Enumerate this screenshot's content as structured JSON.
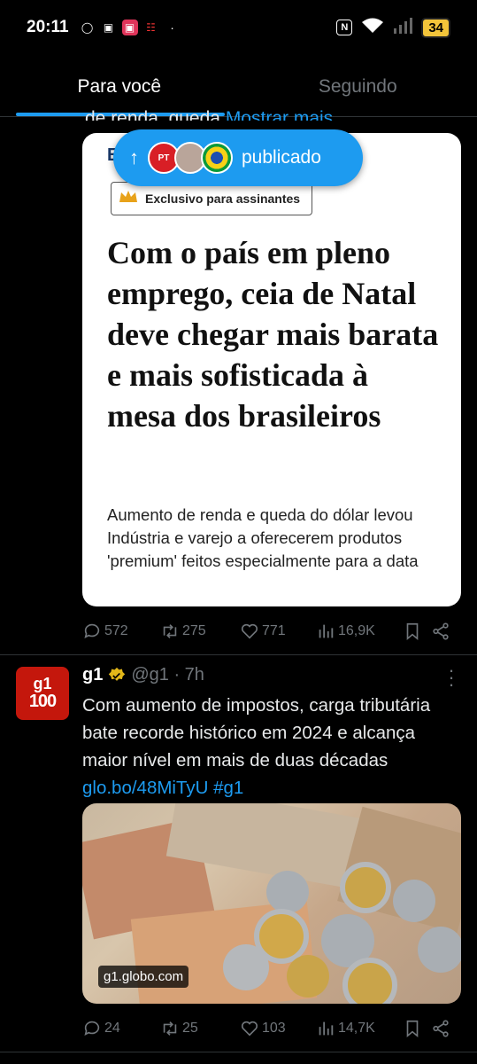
{
  "status_bar": {
    "time": "20:11",
    "battery": "34"
  },
  "tabs": [
    {
      "label": "Para você",
      "active": true
    },
    {
      "label": "Seguindo",
      "active": false
    }
  ],
  "tweet1": {
    "truncated_text": "de renda, queda",
    "show_more": "Mostrar mais",
    "card": {
      "exclusive": "Exclusivo para assinantes",
      "headline": "Com o país em pleno emprego, ceia de Natal deve chegar mais barata e mais sofisticada à mesa dos brasileiros",
      "subhead": "Aumento de renda e queda do dólar levou Indústria e varejo a oferecerem produtos 'premium' feitos especialmente para a data"
    },
    "actions": {
      "replies": "572",
      "retweets": "275",
      "likes": "771",
      "views": "16,9K"
    }
  },
  "published_pill": {
    "label": "publicado",
    "avatar_pt_text": "PT"
  },
  "tweet2": {
    "avatar_top": "g1",
    "avatar_bottom": "100",
    "name": "g1",
    "handle_time": "@g1 · 7h",
    "text": "Com aumento de impostos, carga tributária bate recorde histórico em 2024 e alcança maior nível em mais de duas décadas ",
    "link": "glo.bo/48MiTyU #g1",
    "media_domain": "g1.globo.com",
    "actions": {
      "replies": "24",
      "retweets": "25",
      "likes": "103",
      "views": "14,7K"
    }
  },
  "colors": {
    "accent": "#1d9bf0",
    "g1_red": "#c4170c",
    "verified_gold": "#e2b719"
  }
}
